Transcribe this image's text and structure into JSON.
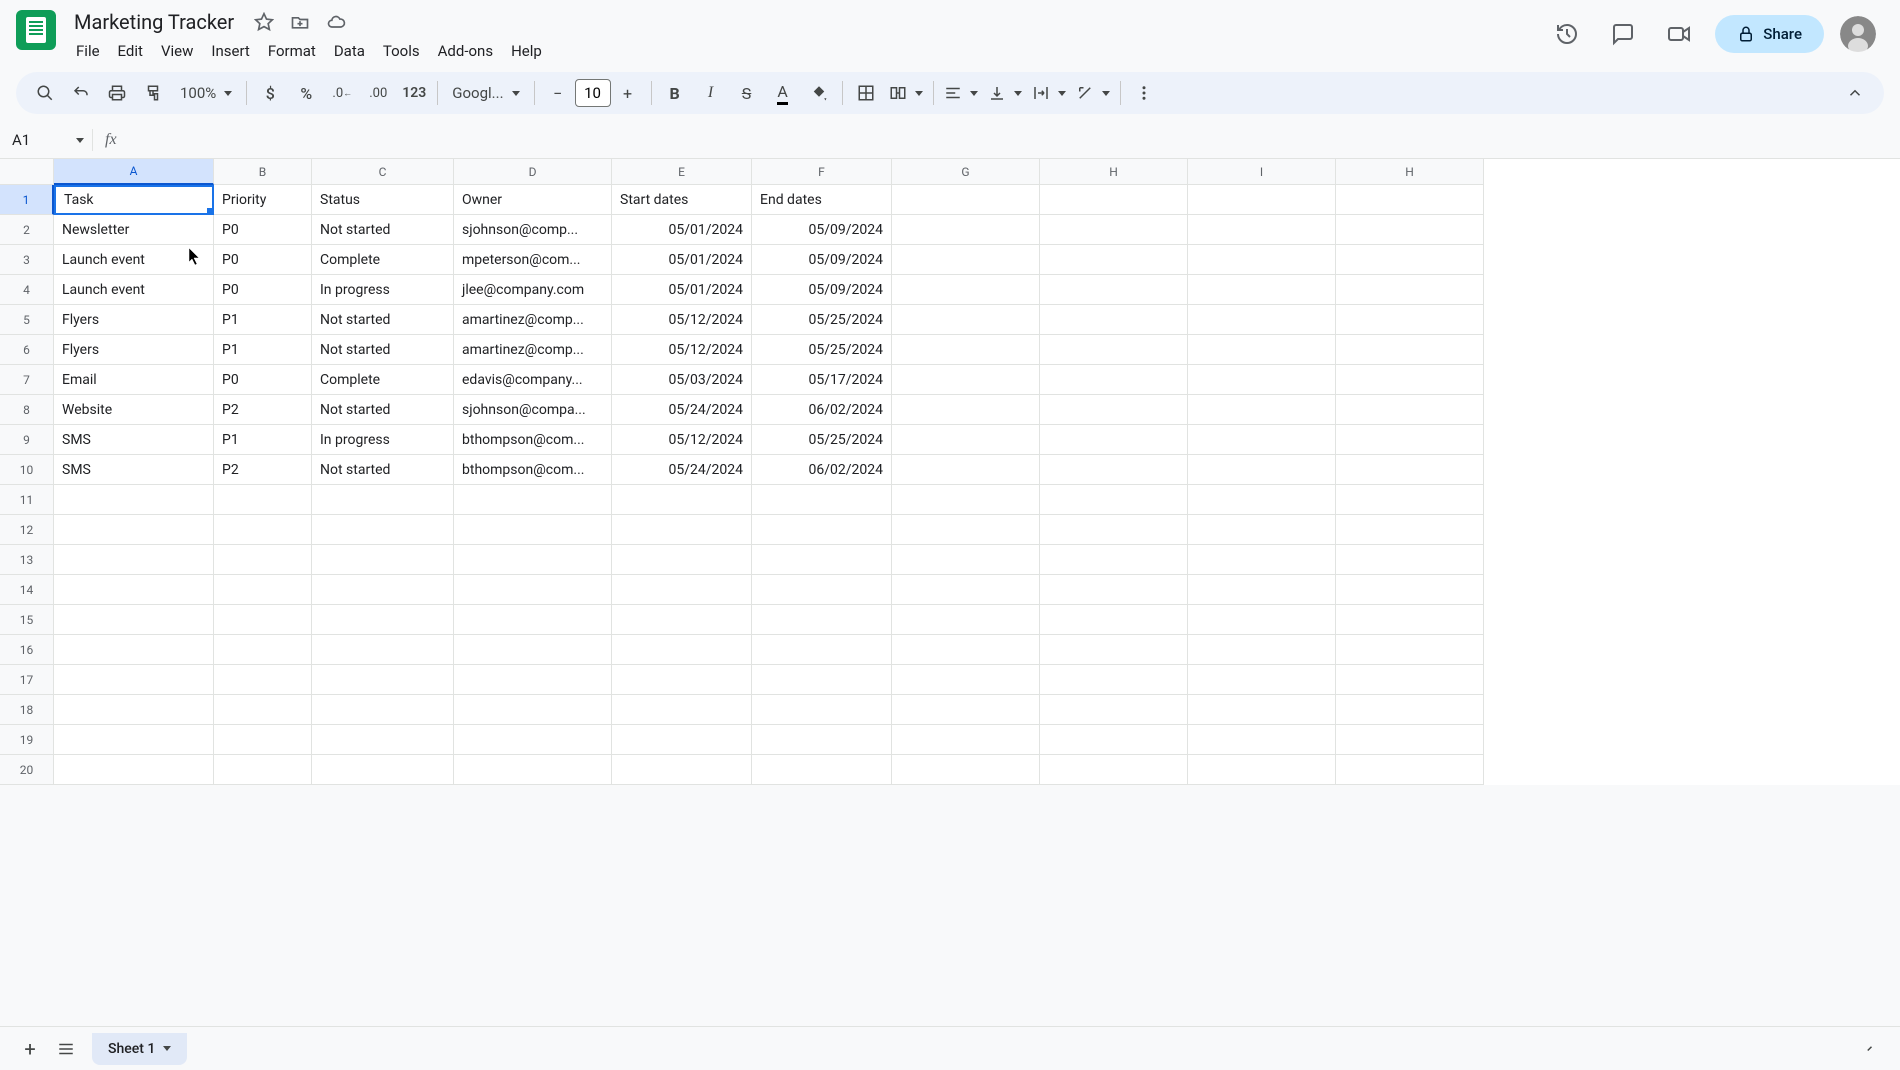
{
  "doc": {
    "title": "Marketing Tracker"
  },
  "menu": {
    "file": "File",
    "edit": "Edit",
    "view": "View",
    "insert": "Insert",
    "format": "Format",
    "data": "Data",
    "tools": "Tools",
    "addons": "Add-ons",
    "help": "Help"
  },
  "toolbar": {
    "zoom": "100%",
    "font": "Googl...",
    "fontSize": "10"
  },
  "share": {
    "label": "Share"
  },
  "namebox": {
    "cell": "A1"
  },
  "columns": [
    "A",
    "B",
    "C",
    "D",
    "E",
    "F",
    "G",
    "H",
    "I",
    "H"
  ],
  "rowCount": 20,
  "headers": {
    "task": "Task",
    "priority": "Priority",
    "status": "Status",
    "owner": "Owner",
    "start": "Start dates",
    "end": "End dates"
  },
  "rows": [
    {
      "task": "Newsletter",
      "priority": "P0",
      "status": "Not started",
      "owner": "sjohnson@comp...",
      "start": "05/01/2024",
      "end": "05/09/2024"
    },
    {
      "task": "Launch event",
      "priority": "P0",
      "status": "Complete",
      "owner": "mpeterson@com...",
      "start": "05/01/2024",
      "end": "05/09/2024"
    },
    {
      "task": "Launch event",
      "priority": "P0",
      "status": "In progress",
      "owner": "jlee@company.com",
      "start": "05/01/2024",
      "end": "05/09/2024"
    },
    {
      "task": "Flyers",
      "priority": "P1",
      "status": "Not started",
      "owner": "amartinez@comp...",
      "start": "05/12/2024",
      "end": "05/25/2024"
    },
    {
      "task": "Flyers",
      "priority": "P1",
      "status": "Not started",
      "owner": "amartinez@comp...",
      "start": "05/12/2024",
      "end": "05/25/2024"
    },
    {
      "task": "Email",
      "priority": "P0",
      "status": "Complete",
      "owner": "edavis@company...",
      "start": "05/03/2024",
      "end": "05/17/2024"
    },
    {
      "task": "Website",
      "priority": "P2",
      "status": "Not started",
      "owner": "sjohnson@compa...",
      "start": "05/24/2024",
      "end": "06/02/2024"
    },
    {
      "task": "SMS",
      "priority": "P1",
      "status": "In progress",
      "owner": "bthompson@com...",
      "start": "05/12/2024",
      "end": "05/25/2024"
    },
    {
      "task": "SMS",
      "priority": "P2",
      "status": "Not started",
      "owner": "bthompson@com...",
      "start": "05/24/2024",
      "end": "06/02/2024"
    }
  ],
  "sheet": {
    "tab": "Sheet 1"
  }
}
